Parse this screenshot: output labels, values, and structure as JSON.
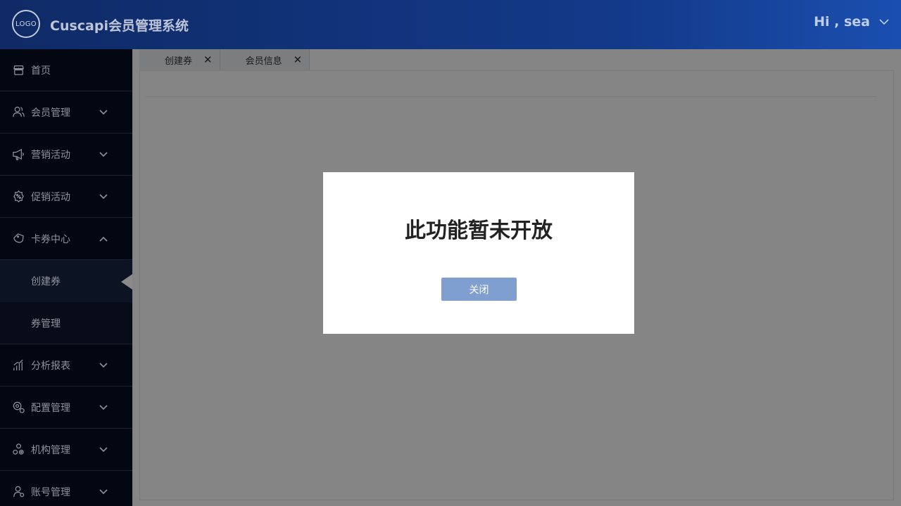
{
  "header": {
    "logo_text": "LOGO",
    "title": "Cuscapi会员管理系统",
    "greeting": "Hi , sea"
  },
  "sidebar": {
    "items": [
      {
        "label": "首页",
        "icon": "store-icon"
      },
      {
        "label": "会员管理",
        "icon": "users-icon",
        "expandable": true
      },
      {
        "label": "营销活动",
        "icon": "megaphone-icon",
        "expandable": true
      },
      {
        "label": "促销活动",
        "icon": "promo-badge-icon",
        "expandable": true
      },
      {
        "label": "卡券中心",
        "icon": "coupon-icon",
        "expandable": true,
        "expanded": true,
        "children": [
          {
            "label": "创建券",
            "active": true
          },
          {
            "label": "券管理"
          }
        ]
      },
      {
        "label": "分析报表",
        "icon": "chart-icon",
        "expandable": true
      },
      {
        "label": "配置管理",
        "icon": "settings-icon",
        "expandable": true
      },
      {
        "label": "机构管理",
        "icon": "org-icon",
        "expandable": true
      },
      {
        "label": "账号管理",
        "icon": "account-icon",
        "expandable": true
      }
    ]
  },
  "tabs": [
    {
      "label": "创建券",
      "close": "✕"
    },
    {
      "label": "会员信息",
      "close": "✕"
    }
  ],
  "modal": {
    "message": "此功能暂未开放",
    "button": "关闭"
  },
  "colors": {
    "header_start": "#0f2a66",
    "header_end": "#1a4fb0",
    "sidebar_bg": "#030711",
    "button_bg": "#7f9fd0"
  }
}
